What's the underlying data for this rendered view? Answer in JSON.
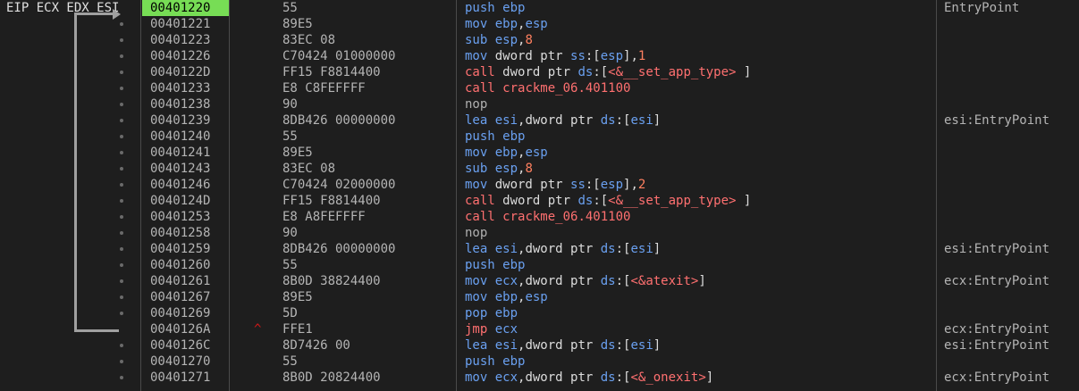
{
  "registers_label": "EIP ECX EDX ESI",
  "colors": {
    "current_address_bg": "#77dd55",
    "mnemonic": "#6aa0f0",
    "call_jump": "#ff7070",
    "immediate": "#ff8060"
  },
  "rows": [
    {
      "addr": "00401220",
      "bytes": "55",
      "dis": [
        [
          "m",
          "push "
        ],
        [
          "r",
          "ebp"
        ]
      ],
      "cmt": "EntryPoint",
      "current": true
    },
    {
      "addr": "00401221",
      "bytes": "89E5",
      "dis": [
        [
          "m",
          "mov "
        ],
        [
          "r",
          "ebp"
        ],
        [
          "pun",
          ","
        ],
        [
          "r",
          "esp"
        ]
      ],
      "cmt": ""
    },
    {
      "addr": "00401223",
      "bytes": "83EC 08",
      "dis": [
        [
          "m",
          "sub "
        ],
        [
          "r",
          "esp"
        ],
        [
          "pun",
          ","
        ],
        [
          "num",
          "8"
        ]
      ],
      "cmt": ""
    },
    {
      "addr": "00401226",
      "bytes": "C70424 01000000",
      "dis": [
        [
          "m",
          "mov "
        ],
        [
          "n",
          "dword ptr "
        ],
        [
          "seg",
          "ss"
        ],
        [
          "pun",
          ":["
        ],
        [
          "r",
          "esp"
        ],
        [
          "pun",
          "],"
        ],
        [
          "num",
          "1"
        ]
      ],
      "cmt": ""
    },
    {
      "addr": "0040122D",
      "bytes": "FF15 F8814400",
      "dis": [
        [
          "cf",
          "call "
        ],
        [
          "n",
          "dword ptr "
        ],
        [
          "seg",
          "ds"
        ],
        [
          "pun",
          ":["
        ],
        [
          "tgt",
          "<&__set_app_type>"
        ],
        [
          "pun",
          " ]"
        ]
      ],
      "cmt": ""
    },
    {
      "addr": "00401233",
      "bytes": "E8 C8FEFFFF",
      "dis": [
        [
          "cf",
          "call "
        ],
        [
          "tgt",
          "crackme_06.401100"
        ]
      ],
      "cmt": ""
    },
    {
      "addr": "00401238",
      "bytes": "90",
      "dis": [
        [
          "nopc",
          "nop"
        ]
      ],
      "cmt": ""
    },
    {
      "addr": "00401239",
      "bytes": "8DB426 00000000",
      "dis": [
        [
          "m",
          "lea "
        ],
        [
          "r",
          "esi"
        ],
        [
          "pun",
          ","
        ],
        [
          "n",
          "dword ptr "
        ],
        [
          "seg",
          "ds"
        ],
        [
          "pun",
          ":["
        ],
        [
          "r",
          "esi"
        ],
        [
          "pun",
          "]"
        ]
      ],
      "cmt": "esi:EntryPoint"
    },
    {
      "addr": "00401240",
      "bytes": "55",
      "dis": [
        [
          "m",
          "push "
        ],
        [
          "r",
          "ebp"
        ]
      ],
      "cmt": ""
    },
    {
      "addr": "00401241",
      "bytes": "89E5",
      "dis": [
        [
          "m",
          "mov "
        ],
        [
          "r",
          "ebp"
        ],
        [
          "pun",
          ","
        ],
        [
          "r",
          "esp"
        ]
      ],
      "cmt": ""
    },
    {
      "addr": "00401243",
      "bytes": "83EC 08",
      "dis": [
        [
          "m",
          "sub "
        ],
        [
          "r",
          "esp"
        ],
        [
          "pun",
          ","
        ],
        [
          "num",
          "8"
        ]
      ],
      "cmt": ""
    },
    {
      "addr": "00401246",
      "bytes": "C70424 02000000",
      "dis": [
        [
          "m",
          "mov "
        ],
        [
          "n",
          "dword ptr "
        ],
        [
          "seg",
          "ss"
        ],
        [
          "pun",
          ":["
        ],
        [
          "r",
          "esp"
        ],
        [
          "pun",
          "],"
        ],
        [
          "num",
          "2"
        ]
      ],
      "cmt": ""
    },
    {
      "addr": "0040124D",
      "bytes": "FF15 F8814400",
      "dis": [
        [
          "cf",
          "call "
        ],
        [
          "n",
          "dword ptr "
        ],
        [
          "seg",
          "ds"
        ],
        [
          "pun",
          ":["
        ],
        [
          "tgt",
          "<&__set_app_type>"
        ],
        [
          "pun",
          " ]"
        ]
      ],
      "cmt": ""
    },
    {
      "addr": "00401253",
      "bytes": "E8 A8FEFFFF",
      "dis": [
        [
          "cf",
          "call "
        ],
        [
          "tgt",
          "crackme_06.401100"
        ]
      ],
      "cmt": ""
    },
    {
      "addr": "00401258",
      "bytes": "90",
      "dis": [
        [
          "nopc",
          "nop"
        ]
      ],
      "cmt": ""
    },
    {
      "addr": "00401259",
      "bytes": "8DB426 00000000",
      "dis": [
        [
          "m",
          "lea "
        ],
        [
          "r",
          "esi"
        ],
        [
          "pun",
          ","
        ],
        [
          "n",
          "dword ptr "
        ],
        [
          "seg",
          "ds"
        ],
        [
          "pun",
          ":["
        ],
        [
          "r",
          "esi"
        ],
        [
          "pun",
          "]"
        ]
      ],
      "cmt": "esi:EntryPoint"
    },
    {
      "addr": "00401260",
      "bytes": "55",
      "dis": [
        [
          "m",
          "push "
        ],
        [
          "r",
          "ebp"
        ]
      ],
      "cmt": ""
    },
    {
      "addr": "00401261",
      "bytes": "8B0D 38824400",
      "dis": [
        [
          "m",
          "mov "
        ],
        [
          "r",
          "ecx"
        ],
        [
          "pun",
          ","
        ],
        [
          "n",
          "dword ptr "
        ],
        [
          "seg",
          "ds"
        ],
        [
          "pun",
          ":["
        ],
        [
          "tgt",
          "<&atexit>"
        ],
        [
          "pun",
          "]"
        ]
      ],
      "cmt": "ecx:EntryPoint"
    },
    {
      "addr": "00401267",
      "bytes": "89E5",
      "dis": [
        [
          "m",
          "mov "
        ],
        [
          "r",
          "ebp"
        ],
        [
          "pun",
          ","
        ],
        [
          "r",
          "esp"
        ]
      ],
      "cmt": ""
    },
    {
      "addr": "00401269",
      "bytes": "5D",
      "dis": [
        [
          "m",
          "pop "
        ],
        [
          "r",
          "ebp"
        ]
      ],
      "cmt": ""
    },
    {
      "addr": "0040126A",
      "bytes": "FFE1",
      "dis": [
        [
          "cf",
          "jmp "
        ],
        [
          "r",
          "ecx"
        ]
      ],
      "cmt": "ecx:EntryPoint",
      "mark": "^"
    },
    {
      "addr": "0040126C",
      "bytes": "8D7426 00",
      "dis": [
        [
          "m",
          "lea "
        ],
        [
          "r",
          "esi"
        ],
        [
          "pun",
          ","
        ],
        [
          "n",
          "dword ptr "
        ],
        [
          "seg",
          "ds"
        ],
        [
          "pun",
          ":["
        ],
        [
          "r",
          "esi"
        ],
        [
          "pun",
          "]"
        ]
      ],
      "cmt": "esi:EntryPoint"
    },
    {
      "addr": "00401270",
      "bytes": "55",
      "dis": [
        [
          "m",
          "push "
        ],
        [
          "r",
          "ebp"
        ]
      ],
      "cmt": ""
    },
    {
      "addr": "00401271",
      "bytes": "8B0D 20824400",
      "dis": [
        [
          "m",
          "mov "
        ],
        [
          "r",
          "ecx"
        ],
        [
          "pun",
          ","
        ],
        [
          "n",
          "dword ptr "
        ],
        [
          "seg",
          "ds"
        ],
        [
          "pun",
          ":["
        ],
        [
          "tgt",
          "<&_onexit>"
        ],
        [
          "pun",
          "]"
        ]
      ],
      "cmt": "ecx:EntryPoint"
    }
  ]
}
